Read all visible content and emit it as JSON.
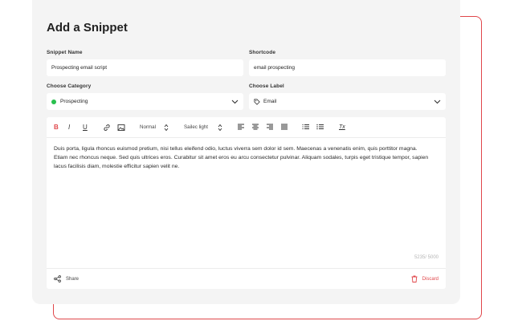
{
  "page": {
    "title": "Add a Snippet"
  },
  "form": {
    "snippet_name": {
      "label": "Snippet Name",
      "value": "Prospecting email script"
    },
    "shortcode": {
      "label": "Shortcode",
      "value": "email prospecting"
    },
    "category": {
      "label": "Choose Category",
      "value": "Prospecting",
      "dot_color": "#29c04e"
    },
    "label": {
      "label": "Choose Label",
      "value": "Email"
    }
  },
  "toolbar": {
    "bold": "B",
    "italic": "I",
    "underline": "U",
    "text_style": "Normal",
    "font": "Sailec light",
    "clear_format": "Tx"
  },
  "editor": {
    "content": "Duis porta, ligula rhoncus euismod pretium, nisi tellus eleifend odio, luctus viverra sem dolor id sem. Maecenas a venenatis enim, quis porttitor magna. Etiam nec rhoncus neque. Sed quis ultrices eros. Curabitur sit amet eros eu arcu consectetur pulvinar. Aliquam sodales, turpis eget tristique tempor, sapien lacus facilisis diam, molestie efficitur sapien velit ne.",
    "char_count": "5235/ 5000"
  },
  "footer": {
    "share": "Share",
    "discard": "Discard"
  },
  "colors": {
    "accent": "#e0464a",
    "card_bg": "#f4f4f4"
  }
}
